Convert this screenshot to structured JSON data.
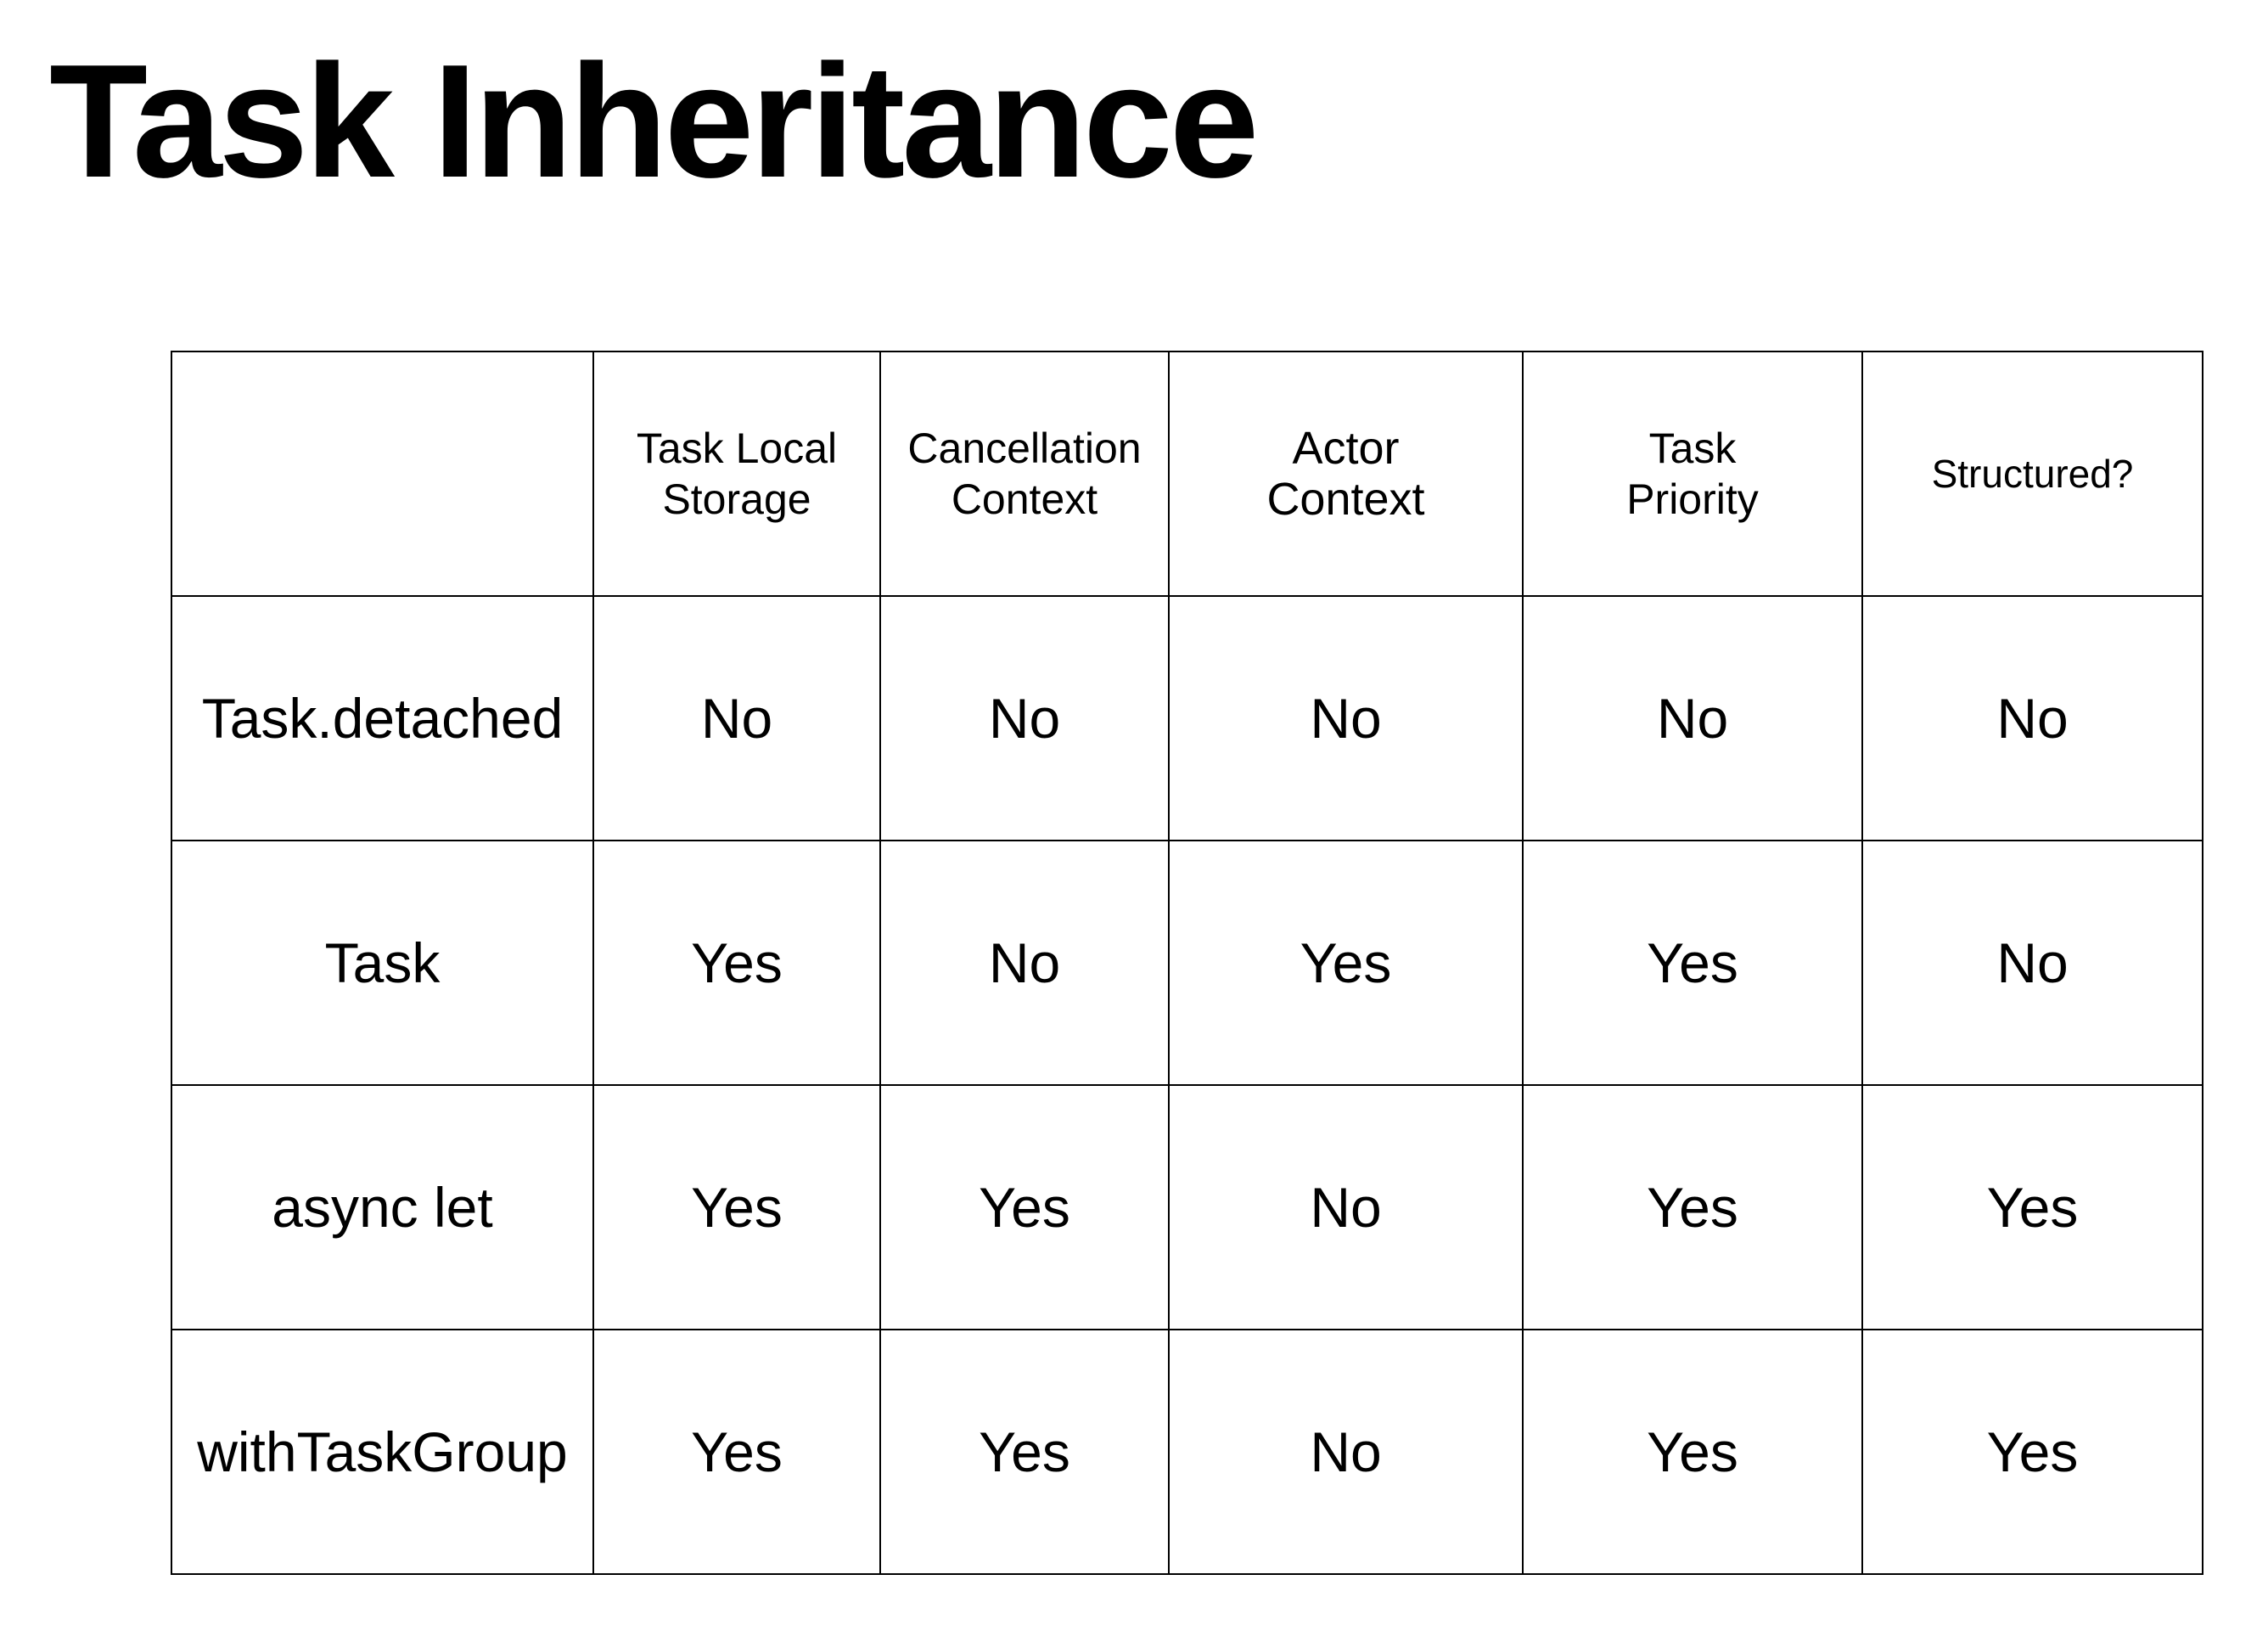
{
  "title": "Task Inheritance",
  "table": {
    "columns": [
      {
        "lines": [
          ""
        ]
      },
      {
        "lines": [
          "Task Local",
          "Storage"
        ]
      },
      {
        "lines": [
          "Cancellation",
          "Context"
        ]
      },
      {
        "lines": [
          "Actor",
          "Context"
        ]
      },
      {
        "lines": [
          "Task",
          "Priority"
        ]
      },
      {
        "lines": [
          "Structured?"
        ]
      }
    ],
    "rows": [
      {
        "label": "Task.detached",
        "cells": [
          "No",
          "No",
          "No",
          "No",
          "No"
        ]
      },
      {
        "label": "Task",
        "cells": [
          "Yes",
          "No",
          "Yes",
          "Yes",
          "No"
        ]
      },
      {
        "label": "async let",
        "cells": [
          "Yes",
          "Yes",
          "No",
          "Yes",
          "Yes"
        ]
      },
      {
        "label": "withTaskGroup",
        "cells": [
          "Yes",
          "Yes",
          "No",
          "Yes",
          "Yes"
        ]
      }
    ]
  }
}
